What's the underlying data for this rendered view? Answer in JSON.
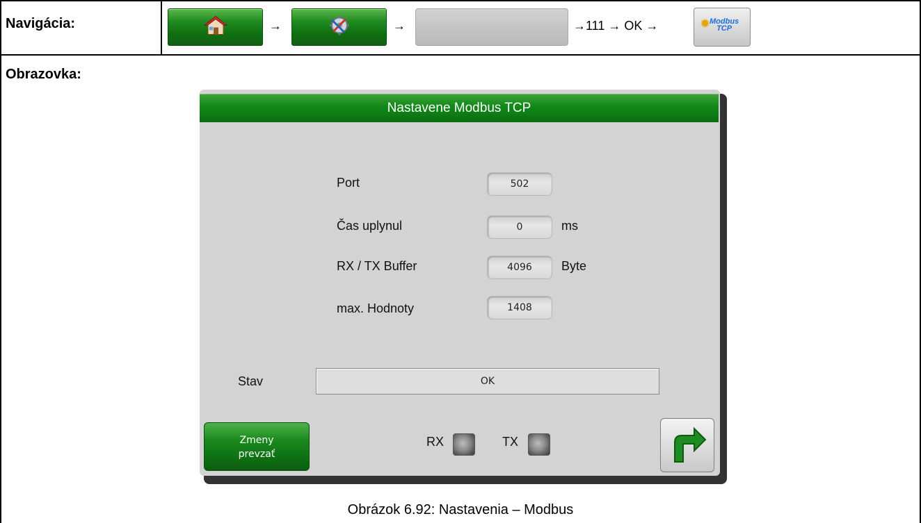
{
  "navigation": {
    "label": "Navigácia:",
    "arrows": [
      "→",
      "→"
    ],
    "path_tail": "→111 → OK →",
    "buttons": [
      {
        "icon": "house-icon"
      },
      {
        "icon": "settings-tools-icon"
      },
      {
        "icon": "blank"
      },
      {
        "icon": "modbus-tcp-icon"
      }
    ],
    "modbus_logo_top": "Modbus",
    "modbus_logo_bottom": "TCP"
  },
  "screen_section": {
    "label": "Obrazovka:"
  },
  "device_screen": {
    "title": "Nastavene Modbus TCP",
    "rows": [
      {
        "label": "Port",
        "value": "502",
        "unit": ""
      },
      {
        "label": "Čas uplynul",
        "value": "0",
        "unit": "ms"
      },
      {
        "label": "RX / TX Buffer",
        "value": "4096",
        "unit": "Byte"
      },
      {
        "label": "max. Hodnoty",
        "value": "1408",
        "unit": ""
      }
    ],
    "status": {
      "label": "Stav",
      "value": "OK"
    },
    "apply_button": {
      "line1": "Zmeny",
      "line2": "prevzať"
    },
    "leds": [
      {
        "label": "RX",
        "state": "off"
      },
      {
        "label": "TX",
        "state": "off"
      }
    ],
    "colors": {
      "title_bar": "#128a18",
      "panel": "#d4d3d3",
      "led_off": "#8a8a8a"
    }
  },
  "caption": "Obrázok 6.92: Nastavenia – Modbus"
}
